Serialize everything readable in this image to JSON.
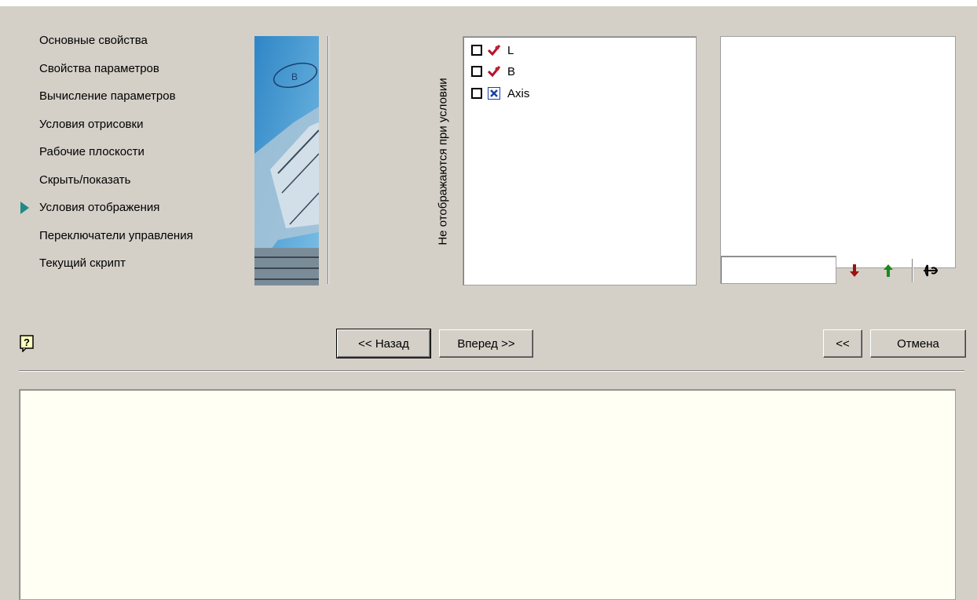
{
  "wizard": {
    "steps": [
      {
        "label": "Основные свойства",
        "active": false
      },
      {
        "label": "Свойства параметров",
        "active": false
      },
      {
        "label": "Вычисление параметров",
        "active": false
      },
      {
        "label": "Условия отрисовки",
        "active": false
      },
      {
        "label": "Рабочие плоскости",
        "active": false
      },
      {
        "label": "Скрыть/показать",
        "active": false
      },
      {
        "label": "Условия отображения",
        "active": true
      },
      {
        "label": "Переключатели управления",
        "active": false
      },
      {
        "label": "Текущий скрипт",
        "active": false
      }
    ],
    "active_step_marker_color": "#1f8a87"
  },
  "conditions": {
    "vertical_label": "Не отображаются при условии",
    "items": [
      {
        "label": "L",
        "checked": false,
        "icon": "parameter-check-icon"
      },
      {
        "label": "B",
        "checked": false,
        "icon": "parameter-check-icon"
      },
      {
        "label": "Axis",
        "checked": false,
        "icon": "axis-x-icon"
      }
    ],
    "condition_value": "",
    "toolbar": {
      "move_down_icon": "red-arrow-down-icon",
      "move_up_icon": "green-arrow-up-icon",
      "edit_icon": "condition-editor-icon"
    }
  },
  "footer": {
    "help_icon": "help-icon",
    "back_label": "<< Назад",
    "next_label": "Вперед >>",
    "collapse_label": "<<",
    "cancel_label": "Отмена"
  },
  "description": {
    "text": ""
  },
  "colors": {
    "background": "#d4d0c8",
    "description_bg": "#fffff4",
    "arrow_down": "#a01010",
    "arrow_up": "#1a8a1a"
  }
}
